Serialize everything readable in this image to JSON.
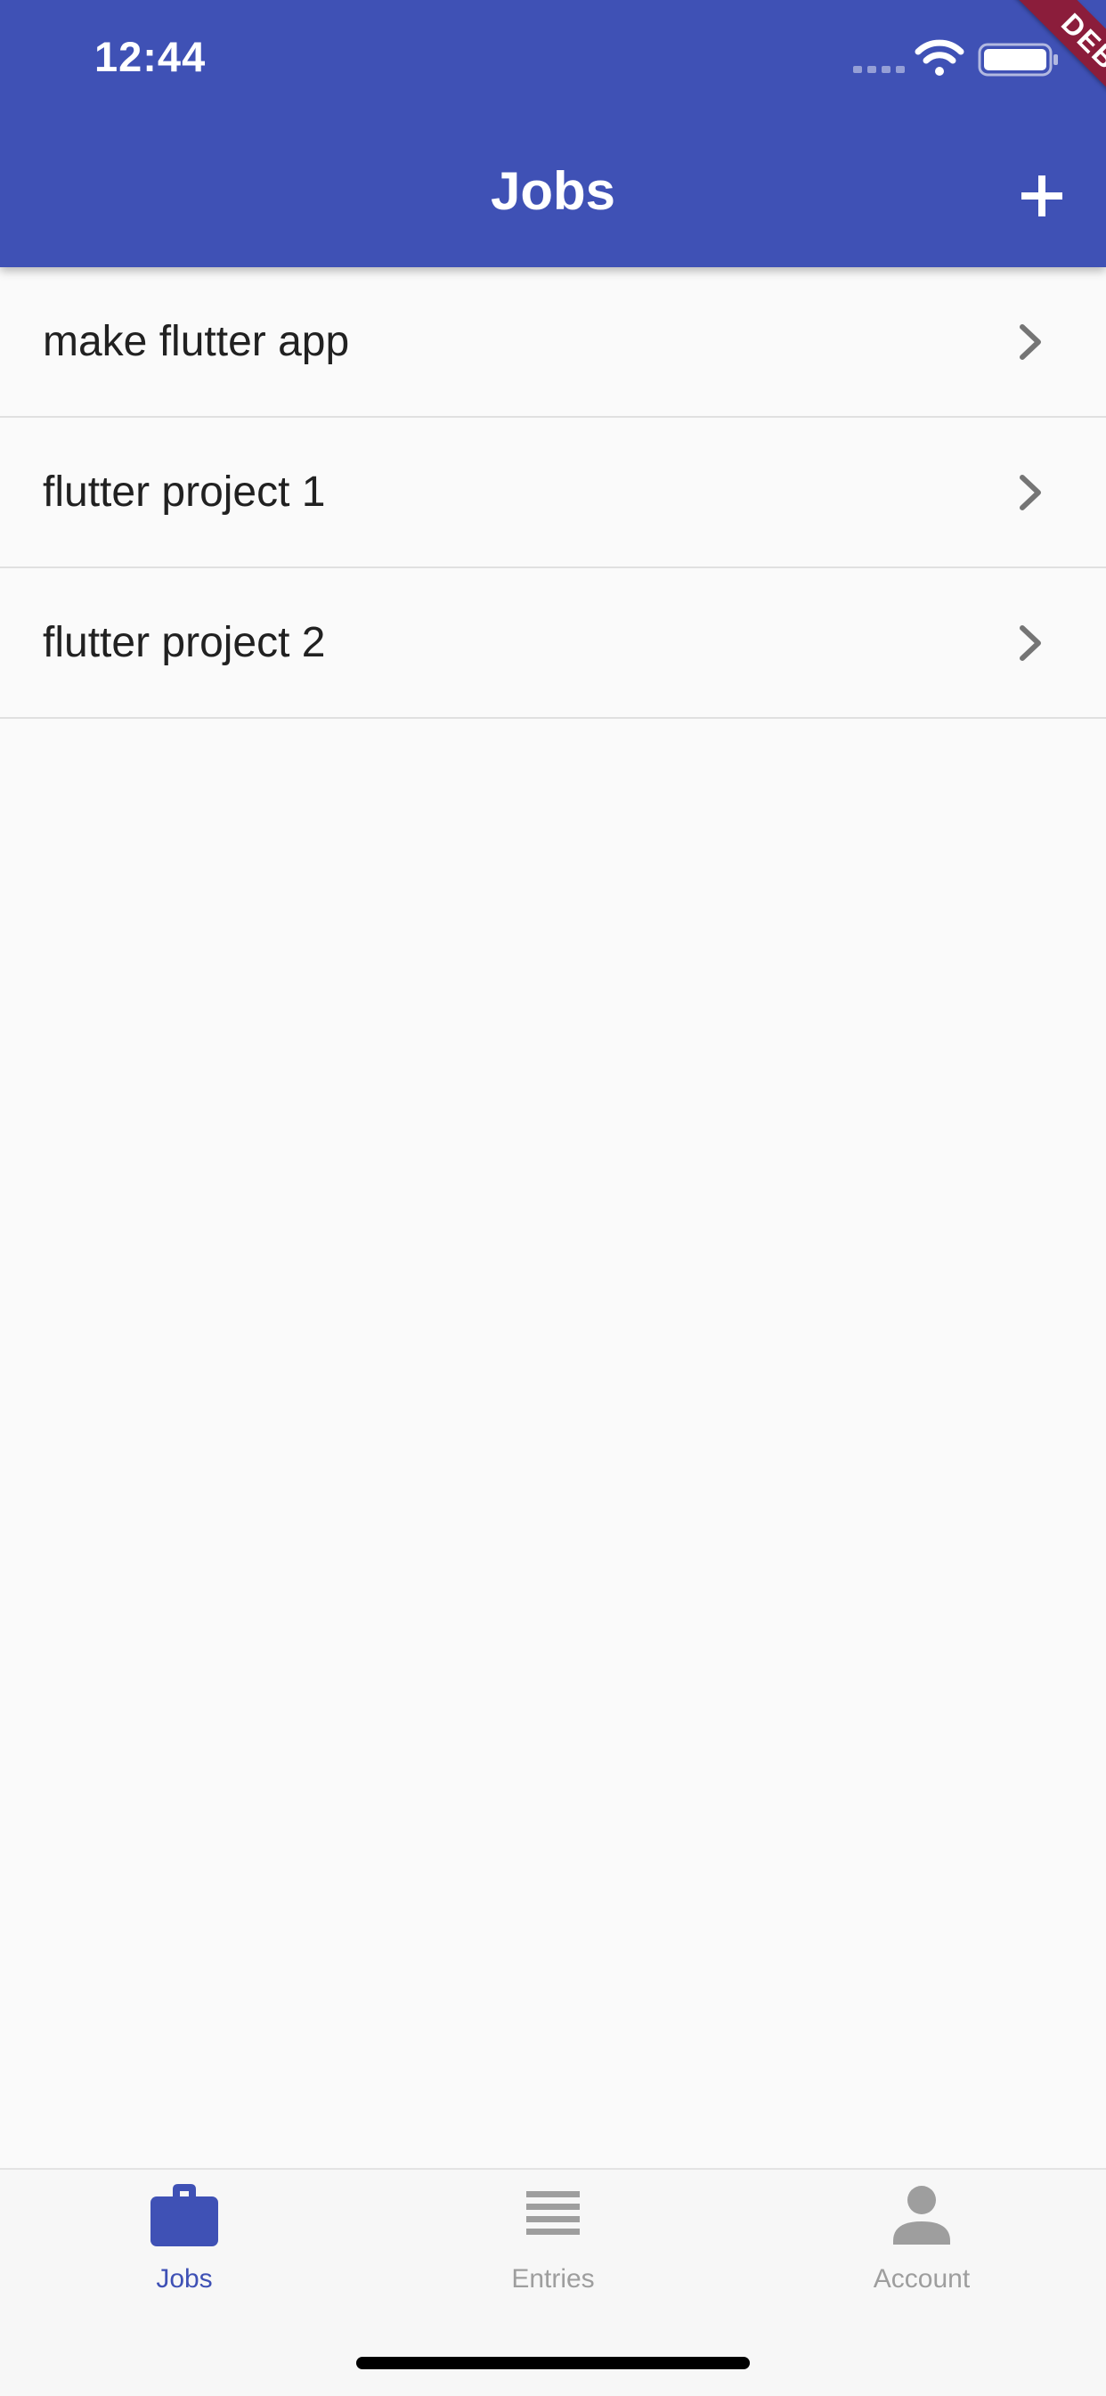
{
  "status_bar": {
    "time": "12:44"
  },
  "debug_banner": {
    "label": "DEBUG"
  },
  "app_bar": {
    "title": "Jobs",
    "add_icon": "plus-icon",
    "background_color": "#3f51b5"
  },
  "jobs": [
    {
      "name": "make flutter app"
    },
    {
      "name": "flutter project 1"
    },
    {
      "name": "flutter project 2"
    }
  ],
  "bottom_nav": {
    "tabs": [
      {
        "label": "Jobs",
        "icon": "briefcase-icon",
        "active": true
      },
      {
        "label": "Entries",
        "icon": "list-icon",
        "active": false
      },
      {
        "label": "Account",
        "icon": "person-icon",
        "active": false
      }
    ],
    "active_color": "#3f51b5",
    "inactive_color": "#9e9e9e"
  }
}
